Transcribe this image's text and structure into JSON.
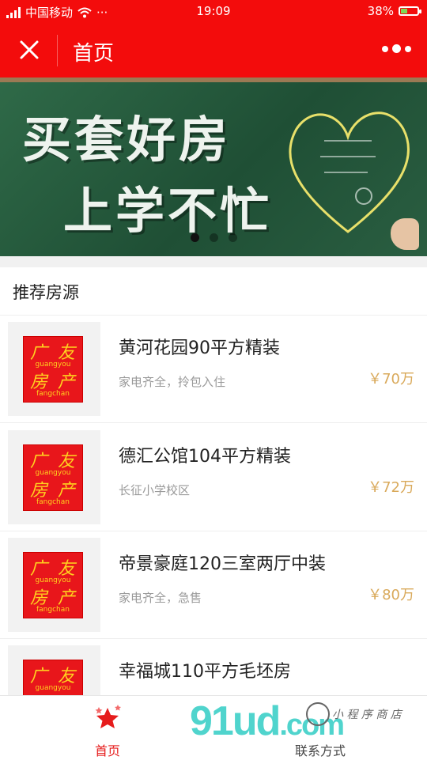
{
  "status_bar": {
    "carrier": "中国移动",
    "dots": "···",
    "time": "19:09",
    "battery": "38%",
    "battery_level": 0.38
  },
  "nav": {
    "title": "首页"
  },
  "banner": {
    "line1": "买套好房",
    "line2": "上学不忙",
    "slide_count": 3,
    "active_slide": 0
  },
  "section": {
    "title": "推荐房源"
  },
  "logo": {
    "char1": "广",
    "char2": "友",
    "pinyin1": "guangyou",
    "char3": "房",
    "char4": "产",
    "pinyin2": "fangchan"
  },
  "listings": [
    {
      "name": "黄河花园90平方精装",
      "desc": "家电齐全，拎包入住",
      "price": "￥70万"
    },
    {
      "name": "德汇公馆104平方精装",
      "desc": "长征小学校区",
      "price": "￥72万"
    },
    {
      "name": "帝景豪庭120三室两厅中装",
      "desc": "家电齐全，急售",
      "price": "￥80万"
    },
    {
      "name": "幸福城110平方毛坯房",
      "desc": "",
      "price": ""
    }
  ],
  "tabbar": {
    "home_label": "首页",
    "contact_label": "联系方式"
  },
  "watermark": {
    "text": "91ud",
    "suffix": ".com",
    "cn": "小 程 序 商 店"
  },
  "colors": {
    "brand_red": "#f30c0c",
    "price_gold": "#d9a95a",
    "watermark_teal": "#3ed0c8"
  }
}
